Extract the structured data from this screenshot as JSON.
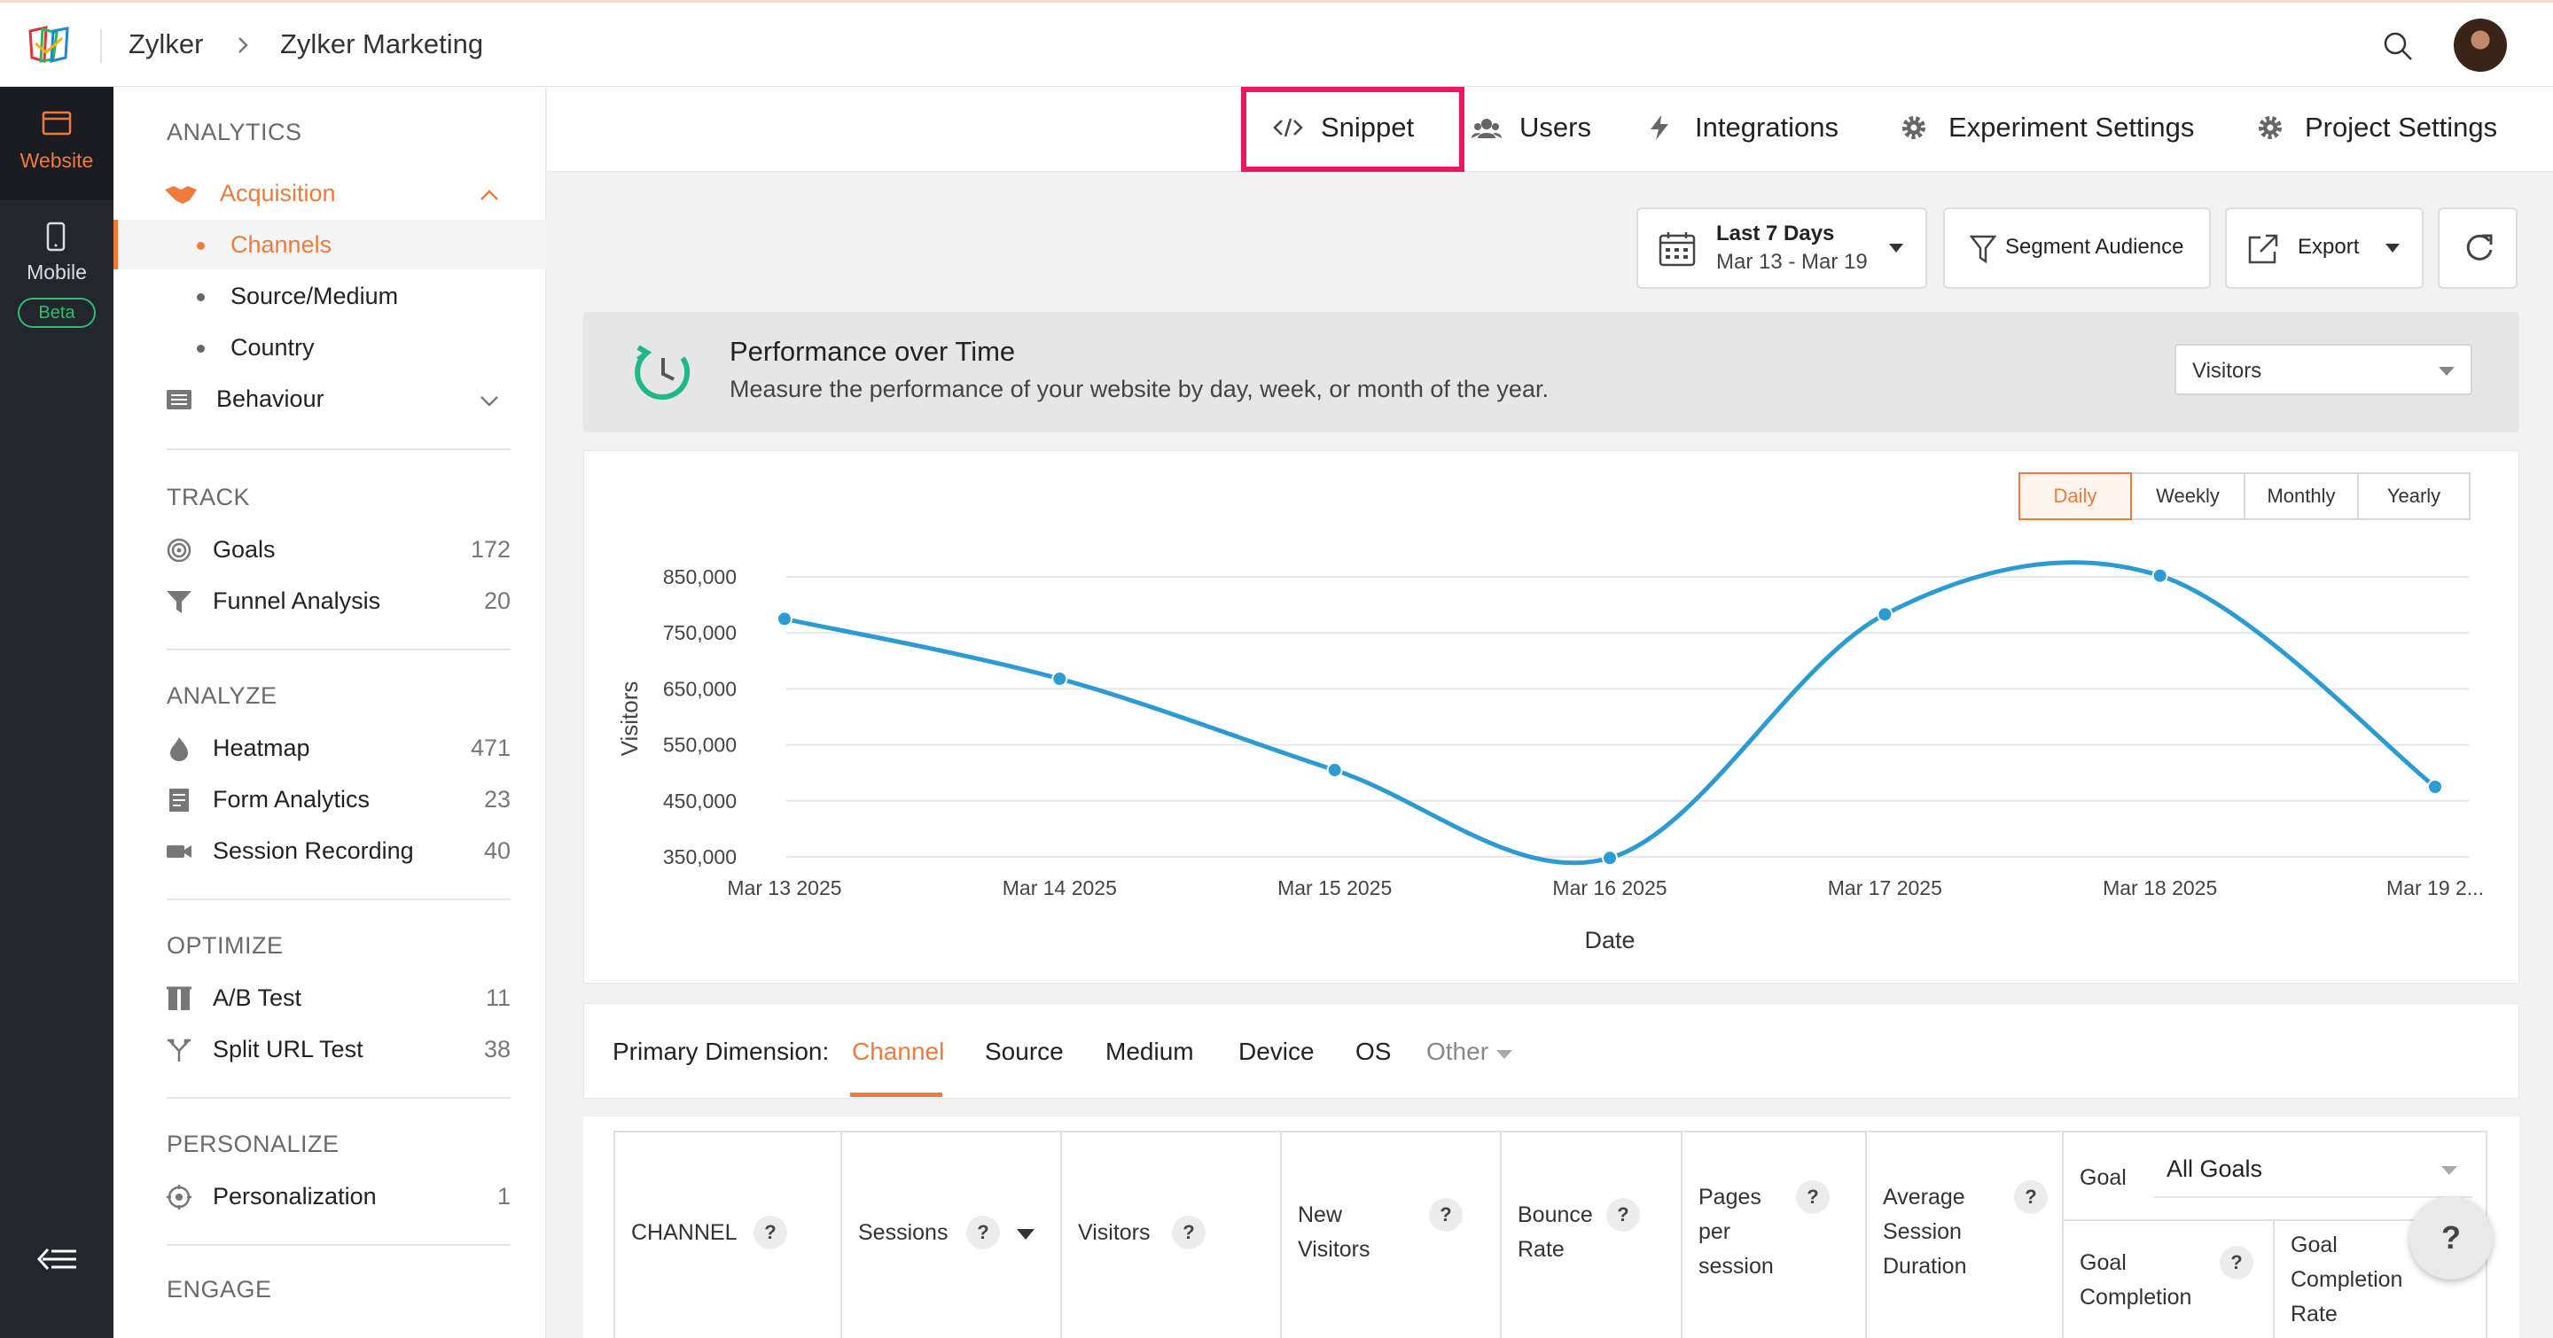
{
  "topbar": {
    "org": "Zylker",
    "project": "Zylker Marketing"
  },
  "rail": {
    "website": "Website",
    "mobile": "Mobile",
    "beta": "Beta"
  },
  "sidenav": {
    "analytics": "ANALYTICS",
    "acquisition": "Acquisition",
    "channels": "Channels",
    "source_medium": "Source/Medium",
    "country": "Country",
    "behaviour": "Behaviour",
    "track": "TRACK",
    "goals": {
      "label": "Goals",
      "count": "172"
    },
    "funnel": {
      "label": "Funnel Analysis",
      "count": "20"
    },
    "analyze": "ANALYZE",
    "heatmap": {
      "label": "Heatmap",
      "count": "471"
    },
    "form_analytics": {
      "label": "Form Analytics",
      "count": "23"
    },
    "session_recording": {
      "label": "Session Recording",
      "count": "40"
    },
    "optimize": "OPTIMIZE",
    "ab_test": {
      "label": "A/B Test",
      "count": "11"
    },
    "split_url": {
      "label": "Split URL Test",
      "count": "38"
    },
    "personalize": "PERSONALIZE",
    "personalization": {
      "label": "Personalization",
      "count": "1"
    },
    "engage": "ENGAGE"
  },
  "tabs": {
    "snippet": "Snippet",
    "users": "Users",
    "integrations": "Integrations",
    "experiment_settings": "Experiment Settings",
    "project_settings": "Project Settings"
  },
  "toolbar": {
    "date_title": "Last 7 Days",
    "date_range": "Mar 13 - Mar 19",
    "segment": "Segment Audience",
    "export": "Export"
  },
  "performance": {
    "title": "Performance over Time",
    "description": "Measure the performance of your website by day, week, or month of the year.",
    "metric": "Visitors"
  },
  "periods": [
    "Daily",
    "Weekly",
    "Monthly",
    "Yearly"
  ],
  "chart_data": {
    "type": "line",
    "x": [
      "Mar 13 2025",
      "Mar 14 2025",
      "Mar 15 2025",
      "Mar 16 2025",
      "Mar 17 2025",
      "Mar 18 2025",
      "Mar 19 2..."
    ],
    "series": [
      {
        "values": [
          775000,
          668000,
          505000,
          348000,
          783000,
          852000,
          475000
        ]
      }
    ],
    "xlabel": "Date",
    "ylabel": "Visitors",
    "yticks": [
      "350,000",
      "450,000",
      "550,000",
      "650,000",
      "750,000",
      "850,000"
    ],
    "ylim": [
      350000,
      850000
    ],
    "grid": true,
    "color": "#2b9bd3"
  },
  "dimension": {
    "label": "Primary Dimension:",
    "tabs": [
      "Channel",
      "Source",
      "Medium",
      "Device",
      "OS",
      "Other"
    ]
  },
  "table": {
    "channel": "CHANNEL",
    "sessions": "Sessions",
    "visitors": "Visitors",
    "new_visitors": [
      "New",
      "Visitors"
    ],
    "bounce_rate": [
      "Bounce",
      "Rate"
    ],
    "pages_per_session": [
      "Pages",
      "per",
      "session"
    ],
    "avg_session": [
      "Average",
      "Session",
      "Duration"
    ],
    "goal": "Goal",
    "all_goals": "All Goals",
    "goal_completion": [
      "Goal",
      "Completion"
    ],
    "goal_completion_rate": [
      "Goal",
      "Completion",
      "Rate"
    ],
    "help": "?"
  },
  "fab": "?"
}
